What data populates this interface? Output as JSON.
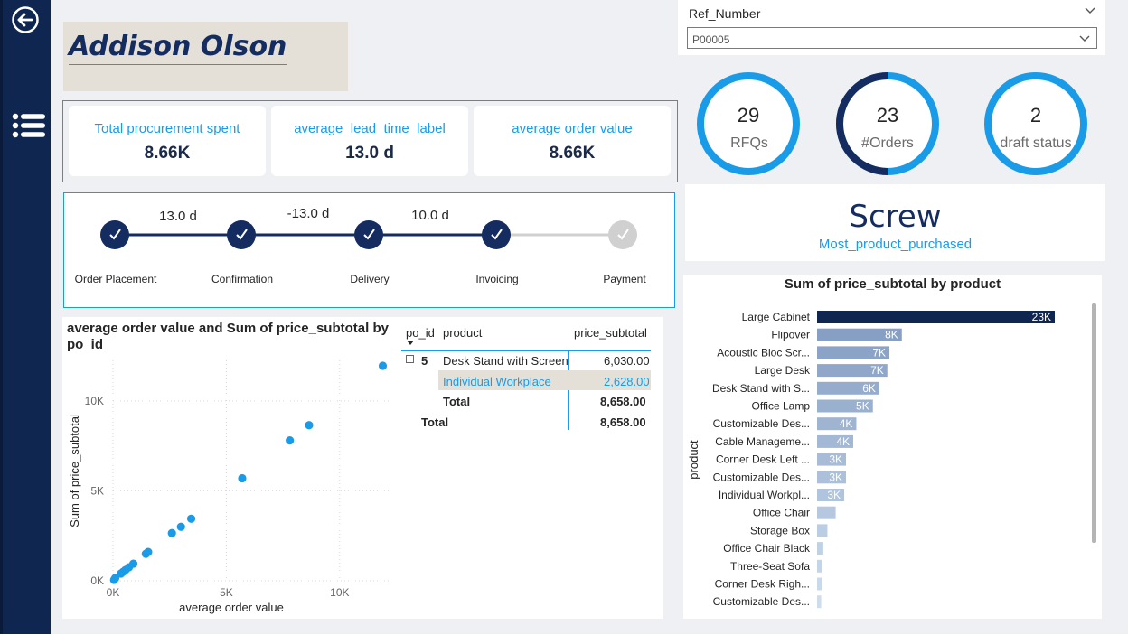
{
  "person_name": "Addison Olson",
  "kpis": [
    {
      "label": "Total procurement spent",
      "value": "8.66K"
    },
    {
      "label": "average_lead_time_label",
      "value": "13.0 d"
    },
    {
      "label": "average order value",
      "value": "8.66K"
    }
  ],
  "timeline": {
    "steps": [
      {
        "label": "Order Placement",
        "done": true
      },
      {
        "label": "Confirmation",
        "done": true
      },
      {
        "label": "Delivery",
        "done": true
      },
      {
        "label": "Invoicing",
        "done": true
      },
      {
        "label": "Payment",
        "done": false
      }
    ],
    "durations": [
      "13.0 d",
      "-13.0 d",
      "10.0 d"
    ]
  },
  "slicer": {
    "title": "Ref_Number",
    "value": "P00005"
  },
  "circles": [
    {
      "value": "29",
      "label": "RFQs"
    },
    {
      "value": "23",
      "label": "#Orders"
    },
    {
      "value": "2",
      "label": "draft status"
    }
  ],
  "top_product": {
    "name": "Screw",
    "label": "Most_product_purchased"
  },
  "table": {
    "headers": [
      "po_id",
      "product",
      "price_subtotal"
    ],
    "group_id": "5",
    "rows": [
      {
        "product": "Desk Stand with Screen",
        "price": "6,030.00"
      },
      {
        "product": "Individual Workplace",
        "price": "2,628.00"
      }
    ],
    "subtotal_label": "Total",
    "subtotal": "8,658.00",
    "total_label": "Total",
    "total": "8,658.00"
  },
  "colors": {
    "navy": "#0f2650",
    "accent": "#1a9be8",
    "highlight": "#e4e0d8"
  },
  "chart_data": [
    {
      "type": "scatter",
      "title": "average order value and Sum of price_subtotal by po_id",
      "xlabel": "average order value",
      "ylabel": "Sum of price_subtotal",
      "xlim": [
        0,
        12000
      ],
      "ylim": [
        0,
        12000
      ],
      "xticks": [
        "0K",
        "5K",
        "10K"
      ],
      "yticks": [
        "0K",
        "5K",
        "10K"
      ],
      "grid": true,
      "points": [
        {
          "x": 50,
          "y": 50
        },
        {
          "x": 100,
          "y": 150
        },
        {
          "x": 350,
          "y": 400
        },
        {
          "x": 450,
          "y": 500
        },
        {
          "x": 550,
          "y": 600
        },
        {
          "x": 700,
          "y": 750
        },
        {
          "x": 900,
          "y": 950
        },
        {
          "x": 1450,
          "y": 1500
        },
        {
          "x": 1550,
          "y": 1600
        },
        {
          "x": 2600,
          "y": 2650
        },
        {
          "x": 3000,
          "y": 3000
        },
        {
          "x": 3450,
          "y": 3450
        },
        {
          "x": 5700,
          "y": 5700
        },
        {
          "x": 7800,
          "y": 7800
        },
        {
          "x": 8650,
          "y": 8650
        },
        {
          "x": 11900,
          "y": 11950
        }
      ]
    },
    {
      "type": "bar",
      "orientation": "horizontal",
      "title": "Sum of price_subtotal by product",
      "ylabel": "product",
      "categories": [
        "Large Cabinet",
        "Flipover",
        "Acoustic Bloc Scr...",
        "Large Desk",
        "Desk Stand with S...",
        "Office Lamp",
        "Customizable Des...",
        "Cable Manageme...",
        "Corner Desk Left ...",
        "Customizable Des...",
        "Individual Workpl...",
        "Office Chair",
        "Storage Box",
        "Office Chair Black",
        "Three-Seat Sofa",
        "Corner Desk Righ...",
        "Customizable Des..."
      ],
      "values": [
        23000,
        8200,
        7000,
        6800,
        6030,
        5400,
        3800,
        3500,
        2800,
        2800,
        2628,
        1800,
        1000,
        600,
        450,
        450,
        400
      ],
      "data_labels": [
        "23K",
        "8K",
        "7K",
        "7K",
        "6K",
        "5K",
        "4K",
        "4K",
        "3K",
        "3K",
        "3K",
        "",
        "",
        "",
        "",
        "",
        ""
      ],
      "xlim": [
        0,
        23000
      ]
    }
  ]
}
